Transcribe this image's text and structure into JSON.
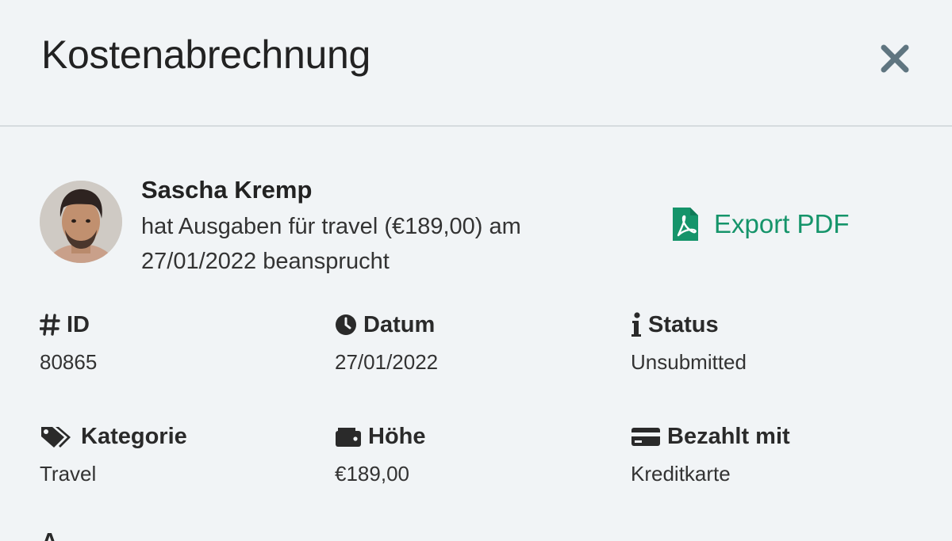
{
  "header": {
    "title": "Kostenabrechnung",
    "close_icon": "close-icon"
  },
  "claim": {
    "user_name": "Sascha Kremp",
    "description": "hat Ausgaben für travel (€189,00) am 27/01/2022 beansprucht",
    "export_label": "Export PDF",
    "export_icon": "pdf-file-icon",
    "accent_color": "#15946a"
  },
  "fields": {
    "id": {
      "label": "ID",
      "value": "80865",
      "icon": "hash-icon"
    },
    "date": {
      "label": "Datum",
      "value": "27/01/2022",
      "icon": "clock-icon"
    },
    "status": {
      "label": "Status",
      "value": "Unsubmitted",
      "icon": "info-icon"
    },
    "category": {
      "label": "Kategorie",
      "value": "Travel",
      "icon": "tags-icon"
    },
    "amount": {
      "label": "Höhe",
      "value": "€189,00",
      "icon": "wallet-icon"
    },
    "paid_with": {
      "label": "Bezahlt mit",
      "value": "Kreditkarte",
      "icon": "credit-card-icon"
    }
  },
  "next_section": {
    "label_partial": "A"
  }
}
